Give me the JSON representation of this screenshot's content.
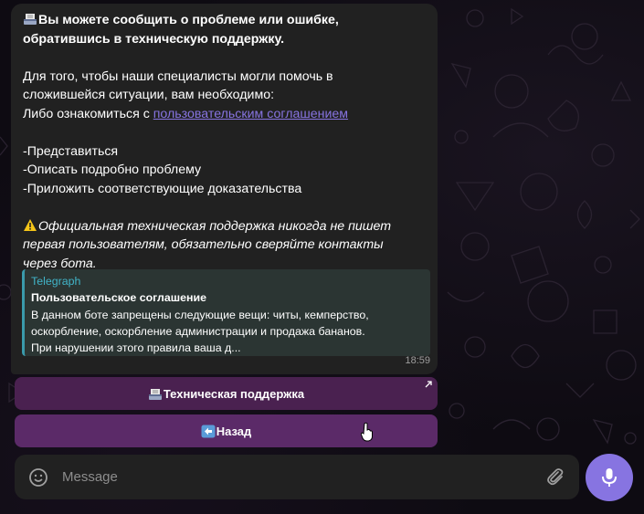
{
  "message": {
    "heading_line1": "Вы можете сообщить о проблеме или ошибке,",
    "heading_line2": "обратившись в техническую поддержку.",
    "intro_line1": "Для того, чтобы наши специалисты могли помочь в",
    "intro_line2": "сложившейся ситуации, вам необходимо:",
    "intro_line3_prefix": "Либо ознакомиться с ",
    "intro_link": "пользовательским соглашением",
    "step1": "-Представиться",
    "step2": "-Описать подробно проблему",
    "step3": "-Приложить соответствующие доказательства",
    "warning_line1": "Официальная техническая поддержка никогда не пишет",
    "warning_line2": "первая пользователям, обязательно сверяйте контакты",
    "warning_line3": "через бота.",
    "time": "18:59"
  },
  "link_preview": {
    "site": "Telegraph",
    "title": "Пользовательское соглашение",
    "desc_line1": "В данном боте запрещены следующие вещи: читы, кемперство,",
    "desc_line2": "оскорбление, оскорбление администрации и продажа бананов.",
    "desc_line3": "При нарушении этого правила ваша д..."
  },
  "keyboard": {
    "support_label": "Техническая поддержка",
    "back_label": "Назад"
  },
  "composer": {
    "placeholder": "Message"
  },
  "colors": {
    "accent": "#8774e1",
    "bubble": "#212121",
    "link_preview_bar": "#3a9aab",
    "button": "#4a2150"
  },
  "icons": [
    "inbox-tray-icon",
    "warning-icon",
    "external-link-icon",
    "left-arrow-icon",
    "smile-icon",
    "paperclip-icon",
    "microphone-icon"
  ]
}
